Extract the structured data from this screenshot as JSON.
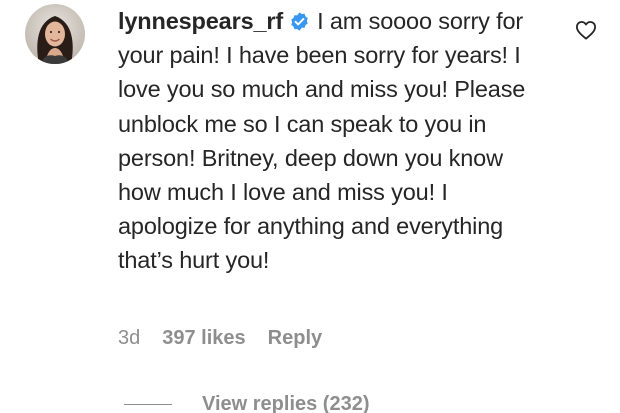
{
  "comment": {
    "username": "lynnespears_rf",
    "text": "I am soooo sorry for your pain! I have been sorry for years! I love you so much and miss you! Please unblock me so I can speak to you in person! Britney, deep down you know how much I love and miss you! I apologize for anything and everything that’s hurt you!",
    "time_ago": "3d",
    "likes": "397 likes",
    "reply_label": "Reply",
    "view_replies_label": "View replies (232)",
    "icons": {
      "verified": "verified-badge-icon",
      "like": "heart-outline-icon"
    },
    "colors": {
      "text": "#262626",
      "secondary": "#8e8e8e",
      "verified": "#3897f0"
    }
  }
}
